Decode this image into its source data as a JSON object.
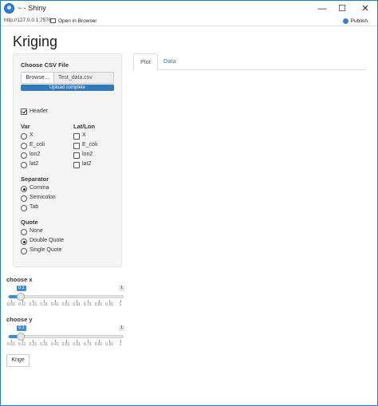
{
  "window": {
    "title": "~ - Shiny",
    "minimize": "—",
    "maximize": "☐",
    "close": "✕"
  },
  "toolbar": {
    "url": "http://127.0.0.1:7576",
    "open_in_browser": "Open in Browser",
    "publish": "Publish"
  },
  "page": {
    "title": "Kriging"
  },
  "file_input": {
    "label": "Choose CSV File",
    "browse": "Browse...",
    "filename": "Test_data.csv",
    "progress_text": "Upload complete",
    "progress_pct": 100
  },
  "header": {
    "label": "Header",
    "checked": true
  },
  "var": {
    "label": "Var",
    "options": [
      "X",
      "E_coli",
      "lon2",
      "lat2"
    ]
  },
  "latlon": {
    "label": "Lat/Lon",
    "options": [
      "X",
      "E_coli",
      "lon2",
      "lat2"
    ]
  },
  "separator": {
    "label": "Separator",
    "options": [
      "Comma",
      "Semicolon",
      "Tab"
    ],
    "selected": "Comma"
  },
  "quote": {
    "label": "Quote",
    "options": [
      "None",
      "Double Quote",
      "Single Quote"
    ],
    "selected": "Double Quote"
  },
  "slider_x": {
    "label": "choose x",
    "value": "0.1",
    "max_label": "1",
    "ticks": [
      "0.01",
      "0.11",
      "0.21",
      "0.31",
      "0.41",
      "0.51",
      "0.61",
      "0.71",
      "0.81",
      "0.91",
      "1"
    ]
  },
  "slider_y": {
    "label": "choose y",
    "value": "0.1",
    "max_label": "1",
    "ticks": [
      "0.01",
      "0.11",
      "0.21",
      "0.31",
      "0.41",
      "0.51",
      "0.61",
      "0.71",
      "0.81",
      "0.91",
      "1"
    ]
  },
  "krige_button": "Krige",
  "tabs": [
    {
      "label": "Plot",
      "active": true
    },
    {
      "label": "Data",
      "active": false
    }
  ]
}
